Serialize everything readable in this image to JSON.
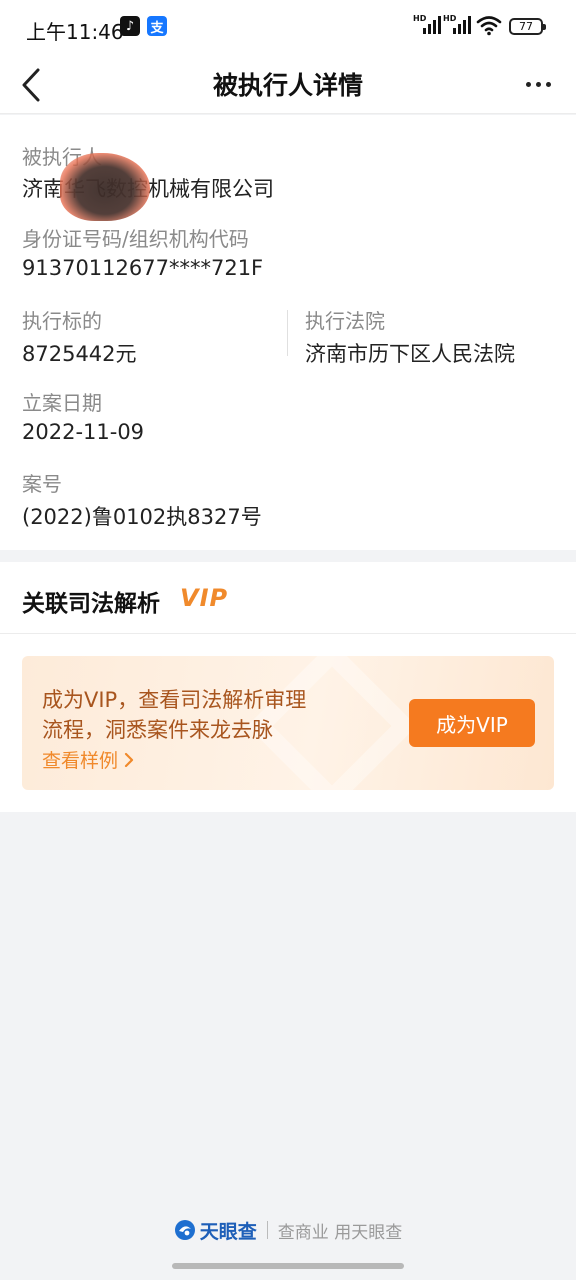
{
  "status_bar": {
    "time": "上午11:46",
    "battery": "77",
    "signal_labels": [
      "HD",
      "HD"
    ],
    "icons": [
      "tiktok-icon",
      "alipay-icon",
      "signal-icon",
      "wifi-icon",
      "battery-icon"
    ]
  },
  "nav": {
    "title": "被执行人详情",
    "icons": [
      "back-icon",
      "more-icon"
    ]
  },
  "details": {
    "executed_person": {
      "label": "被执行人",
      "value": "济南华飞数控机械有限公司"
    },
    "id_code": {
      "label": "身份证号码/组织机构代码",
      "value": "91370112677****721F"
    },
    "subject": {
      "label": "执行标的",
      "value": "8725442元"
    },
    "court": {
      "label": "执行法院",
      "value": "济南市历下区人民法院"
    },
    "filing_date": {
      "label": "立案日期",
      "value": "2022-11-09"
    },
    "case_no": {
      "label": "案号",
      "value": "(2022)鲁0102执8327号"
    }
  },
  "judicial": {
    "title": "关联司法解析",
    "vip_badge": "VIP",
    "promo_line1": "成为VIP，查看司法解析审理",
    "promo_line2": "流程，洞悉案件来龙去脉",
    "sample_link": "查看样例",
    "cta": "成为VIP"
  },
  "footer": {
    "brand": "天眼查",
    "slogan": "查商业 用天眼查"
  },
  "colors": {
    "accent_orange": "#f57a1f",
    "promo_text": "#a8551e",
    "brand_blue": "#1e5fb8"
  }
}
